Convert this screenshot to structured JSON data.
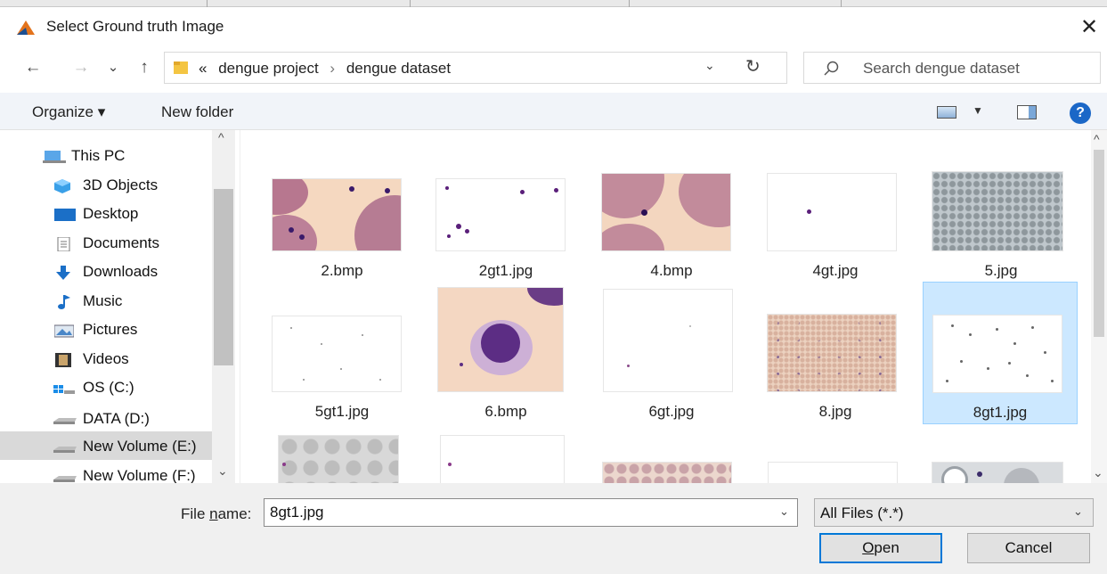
{
  "window": {
    "title": "Select Ground truth Image",
    "close_glyph": "✕",
    "app_icon": "matlab-icon"
  },
  "nav": {
    "back_glyph": "←",
    "forward_glyph": "→",
    "recent_glyph": "⌄",
    "up_glyph": "↑",
    "breadcrumb_overflow": "«",
    "breadcrumb": [
      "dengue project",
      "dengue dataset"
    ],
    "breadcrumb_sep": "›",
    "dropdown_glyph": "⌄",
    "refresh_glyph": "↻",
    "search_placeholder": "Search dengue dataset"
  },
  "toolbar": {
    "organize_label": "Organize ▾",
    "new_folder_label": "New folder",
    "help_label": "?",
    "view_drop_glyph": "▼"
  },
  "sidebar": {
    "items": [
      {
        "label": "This PC",
        "icon": "computer-icon"
      },
      {
        "label": "3D Objects",
        "icon": "cube-icon"
      },
      {
        "label": "Desktop",
        "icon": "desktop-icon"
      },
      {
        "label": "Documents",
        "icon": "document-icon"
      },
      {
        "label": "Downloads",
        "icon": "download-icon"
      },
      {
        "label": "Music",
        "icon": "music-icon"
      },
      {
        "label": "Pictures",
        "icon": "pictures-icon"
      },
      {
        "label": "Videos",
        "icon": "film-icon"
      },
      {
        "label": "OS (C:)",
        "icon": "windows-drive-icon"
      },
      {
        "label": "DATA (D:)",
        "icon": "drive-icon"
      },
      {
        "label": "New Volume (E:)",
        "icon": "drive-icon",
        "selected": true
      },
      {
        "label": "New Volume (F:)",
        "icon": "drive-icon"
      }
    ],
    "scroll_up_glyph": "^",
    "scroll_down_glyph": "⌄"
  },
  "files": [
    {
      "name": "2.bmp"
    },
    {
      "name": "2gt1.jpg"
    },
    {
      "name": "4.bmp"
    },
    {
      "name": "4gt.jpg"
    },
    {
      "name": "5.jpg"
    },
    {
      "name": "5gt1.jpg"
    },
    {
      "name": "6.bmp"
    },
    {
      "name": "6gt.jpg"
    },
    {
      "name": "8.jpg"
    },
    {
      "name": "8gt1.jpg",
      "selected": true
    }
  ],
  "footer": {
    "file_name_label_pre": "File ",
    "file_name_label_u": "n",
    "file_name_label_post": "ame:",
    "file_name_value": "8gt1.jpg",
    "file_type_value": "All Files (*.*)",
    "open_label_u": "O",
    "open_label_rest": "pen",
    "cancel_label": "Cancel",
    "dropdown_glyph": "⌄"
  },
  "colors": {
    "selection": "#cce8ff",
    "selection_border": "#99d1ff",
    "accent": "#0078d7",
    "help": "#1b67c7"
  }
}
